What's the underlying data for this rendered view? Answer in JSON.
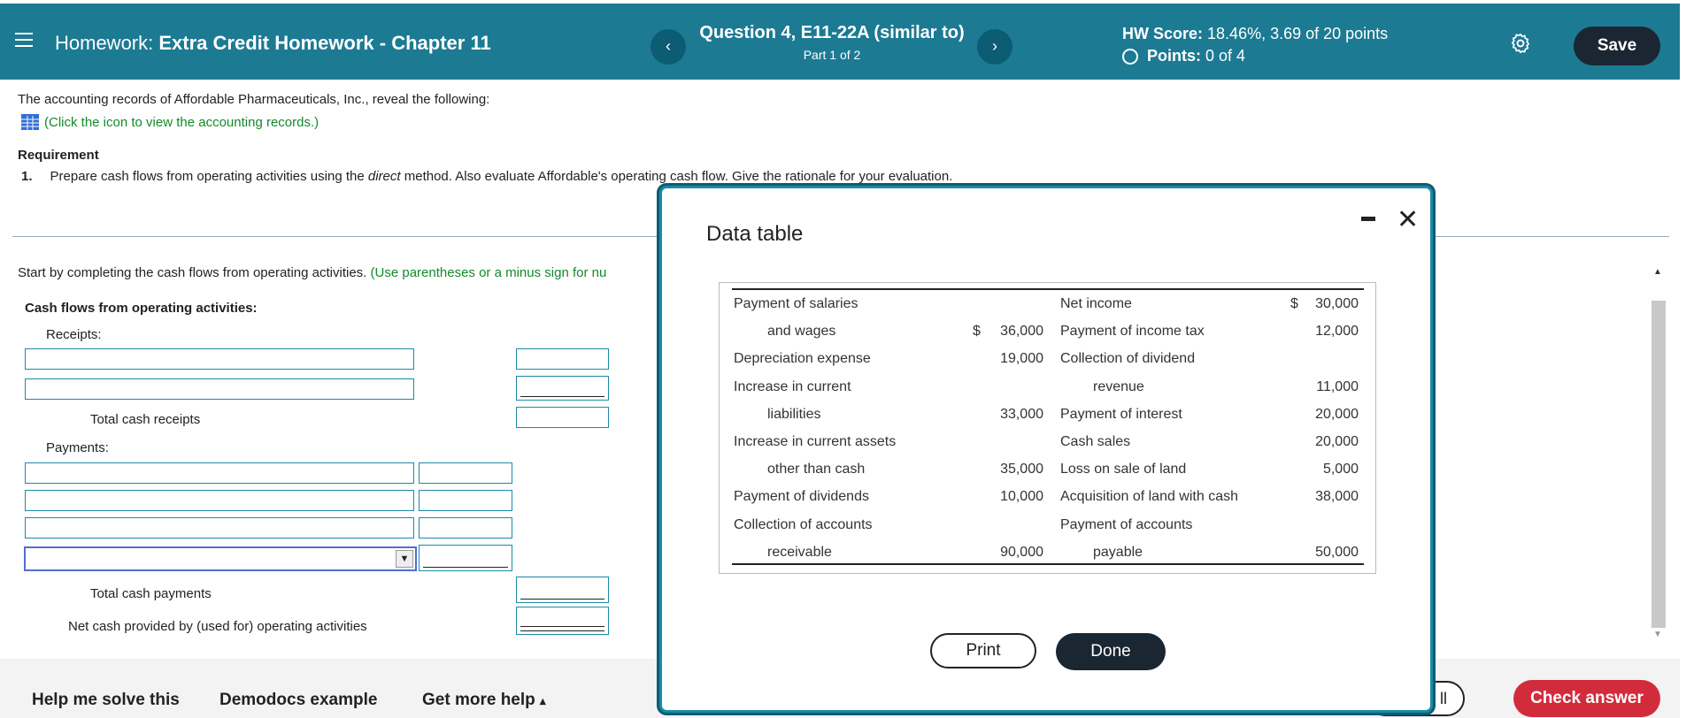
{
  "header": {
    "hw_prefix": "Homework:",
    "hw_name": "Extra Credit Homework - Chapter 11",
    "question_title": "Question 4, E11-22A (similar to)",
    "question_part": "Part 1 of 2",
    "hw_score_label": "HW Score:",
    "hw_score_value": "18.46%, 3.69 of 20 points",
    "points_label": "Points:",
    "points_value": "0 of 4",
    "prev_icon": "chevron-left-icon",
    "next_icon": "chevron-right-icon",
    "save_label": "Save",
    "colors": {
      "bar": "#1c7a93",
      "nav": "#0c5c73",
      "save": "#1b2633"
    }
  },
  "question": {
    "prompt": "The accounting records of Affordable Pharmaceuticals, Inc., reveal the following:",
    "click_hint": "(Click the icon to view the accounting records.)",
    "requirement_title": "Requirement",
    "requirement_number": "1.",
    "requirement_text_a": "Prepare cash flows from operating activities using the",
    "requirement_text_em": "direct",
    "requirement_text_b": "method. Also evaluate Affordable's operating cash flow. Give the rationale for your evaluation.",
    "start_text": "Start by completing the cash flows from operating activities.",
    "start_hint": "(Use parentheses or a minus sign for nu"
  },
  "form": {
    "section_title": "Cash flows from operating activities:",
    "receipts_label": "Receipts:",
    "total_receipts_label": "Total cash receipts",
    "payments_label": "Payments:",
    "total_payments_label": "Total cash payments",
    "net_cash_label": "Net cash provided by (used for) operating activities"
  },
  "modal": {
    "title": "Data table",
    "rows": [
      {
        "l_label": "Payment of salaries",
        "l_indent": false,
        "l_dollar": "",
        "l_value": "",
        "r_label": "Net income",
        "r_indent": false,
        "r_dollar": "$",
        "r_value": "30,000"
      },
      {
        "l_label": "and wages",
        "l_indent": true,
        "l_dollar": "$",
        "l_value": "36,000",
        "r_label": "Payment of income tax",
        "r_indent": false,
        "r_dollar": "",
        "r_value": "12,000"
      },
      {
        "l_label": "Depreciation expense",
        "l_indent": false,
        "l_dollar": "",
        "l_value": "19,000",
        "r_label": "Collection of dividend",
        "r_indent": false,
        "r_dollar": "",
        "r_value": ""
      },
      {
        "l_label": "Increase in current",
        "l_indent": false,
        "l_dollar": "",
        "l_value": "",
        "r_label": "revenue",
        "r_indent": true,
        "r_dollar": "",
        "r_value": "11,000"
      },
      {
        "l_label": "liabilities",
        "l_indent": true,
        "l_dollar": "",
        "l_value": "33,000",
        "r_label": "Payment of interest",
        "r_indent": false,
        "r_dollar": "",
        "r_value": "20,000"
      },
      {
        "l_label": "Increase in current assets",
        "l_indent": false,
        "l_dollar": "",
        "l_value": "",
        "r_label": "Cash sales",
        "r_indent": false,
        "r_dollar": "",
        "r_value": "20,000"
      },
      {
        "l_label": "other than cash",
        "l_indent": true,
        "l_dollar": "",
        "l_value": "35,000",
        "r_label": "Loss on sale of land",
        "r_indent": false,
        "r_dollar": "",
        "r_value": "5,000"
      },
      {
        "l_label": "Payment of dividends",
        "l_indent": false,
        "l_dollar": "",
        "l_value": "10,000",
        "r_label": "Acquisition of land with cash",
        "r_indent": false,
        "r_dollar": "",
        "r_value": "38,000"
      },
      {
        "l_label": "Collection of accounts",
        "l_indent": false,
        "l_dollar": "",
        "l_value": "",
        "r_label": "Payment of accounts",
        "r_indent": false,
        "r_dollar": "",
        "r_value": ""
      },
      {
        "l_label": "receivable",
        "l_indent": true,
        "l_dollar": "",
        "l_value": "90,000",
        "r_label": "payable",
        "r_indent": true,
        "r_dollar": "",
        "r_value": "50,000"
      }
    ],
    "print_label": "Print",
    "done_label": "Done"
  },
  "footer": {
    "help_label": "Help me solve this",
    "demodocs_label": "Demodocs example",
    "more_help_label": "Get more help",
    "more_help_caret": "▴",
    "clear_label": "ll",
    "check_label": "Check answer",
    "check_color": "#d22c3c"
  }
}
